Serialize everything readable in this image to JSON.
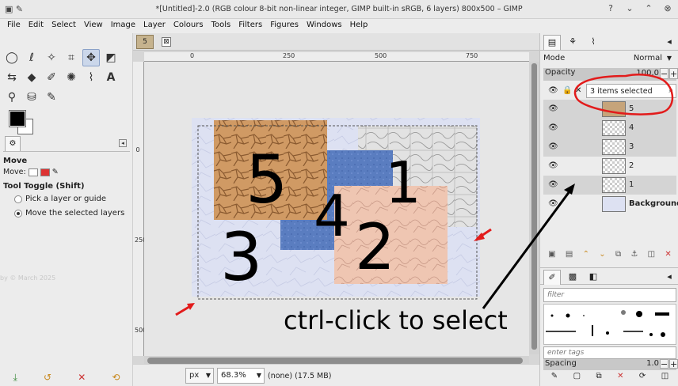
{
  "window": {
    "title": "*[Untitled]-2.0 (RGB colour 8-bit non-linear integer, GIMP built-in sRGB, 6 layers) 800x500 – GIMP"
  },
  "menu": [
    "File",
    "Edit",
    "Select",
    "View",
    "Image",
    "Layer",
    "Colours",
    "Tools",
    "Filters",
    "Figures",
    "Windows",
    "Help"
  ],
  "tool_options": {
    "title": "Move",
    "move_label": "Move:",
    "toggle_label": "Tool Toggle  (Shift)",
    "options": [
      "Pick a layer or guide",
      "Move the selected layers"
    ],
    "selected_index": 1
  },
  "watermark": "by © March 2025",
  "rulers": {
    "h": [
      "0",
      "250",
      "500",
      "750"
    ],
    "v": [
      "0",
      "250",
      "500"
    ]
  },
  "statusbar": {
    "unit": "px",
    "zoom": "68.3%",
    "info": "(none) (17.5 MB)"
  },
  "layers_panel": {
    "mode_label": "Mode",
    "mode_value": "Normal",
    "opacity_label": "Opacity",
    "opacity_value": "100.0",
    "selected_text": "3 items selected",
    "layers": [
      {
        "name": "5",
        "selected": true
      },
      {
        "name": "4",
        "selected": true
      },
      {
        "name": "3",
        "selected": true
      },
      {
        "name": "2",
        "selected": false
      },
      {
        "name": "1",
        "selected": true
      },
      {
        "name": "Background",
        "selected": false
      }
    ]
  },
  "brushes_panel": {
    "filter_placeholder": "filter",
    "tags_placeholder": "enter tags",
    "spacing_label": "Spacing",
    "spacing_value": "1.0"
  },
  "canvas": {
    "labels": [
      "5",
      "4",
      "1",
      "3",
      "2"
    ]
  },
  "annotation": {
    "text": "ctrl-click to select"
  }
}
